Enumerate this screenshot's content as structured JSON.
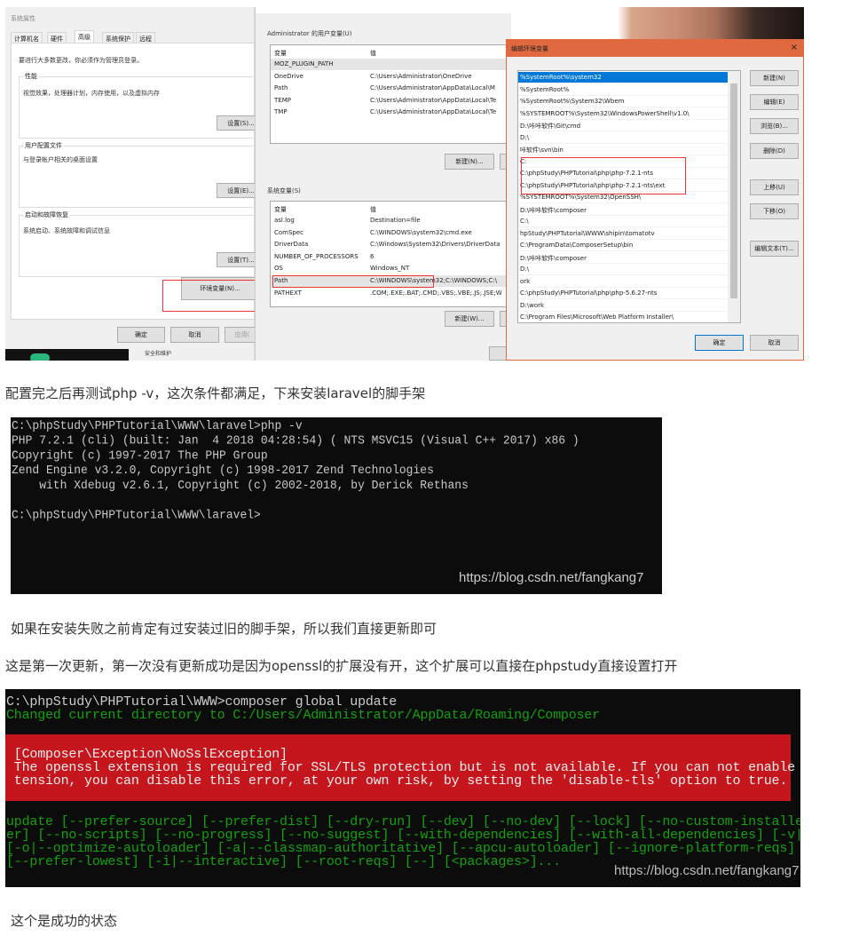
{
  "screenshot1": {
    "system_properties": {
      "title": "系统属性",
      "tabs": [
        "计算机名",
        "硬件",
        "高级",
        "系统保护",
        "远程"
      ],
      "active_tab": "高级",
      "admin_note": "要进行大多数更改，你必须作为管理员登录。",
      "groups": [
        {
          "label": "性能",
          "desc": "视觉效果，处理器计划，内存使用，以及虚拟内存",
          "button": "设置(S)..."
        },
        {
          "label": "用户配置文件",
          "desc": "与登录帐户相关的桌面设置",
          "button": "设置(E)..."
        },
        {
          "label": "启动和故障恢复",
          "desc": "系统启动、系统故障和调试信息",
          "button": "设置(T)..."
        }
      ],
      "env_button": "环境变量(N)...",
      "ok": "确定",
      "cancel": "取消",
      "apply": "应用(",
      "behind_text": "安全和维护"
    },
    "env_vars": {
      "user_label": "Administrator 的用户变量(U)",
      "col_var": "变量",
      "col_val": "值",
      "user_rows": [
        [
          "MOZ_PLUGIN_PATH",
          ""
        ],
        [
          "OneDrive",
          "C:\\Users\\Administrator\\OneDrive"
        ],
        [
          "Path",
          "C:\\Users\\Administrator\\AppData\\Local\\M"
        ],
        [
          "TEMP",
          "C:\\Users\\Administrator\\AppData\\Local\\Te"
        ],
        [
          "TMP",
          "C:\\Users\\Administrator\\AppData\\Local\\Te"
        ]
      ],
      "user_new": "新建(N)...",
      "sys_label": "系统变量(S)",
      "sys_rows": [
        [
          "asl.log",
          "Destination=file"
        ],
        [
          "ComSpec",
          "C:\\WINDOWS\\system32\\cmd.exe"
        ],
        [
          "DriverData",
          "C:\\Windows\\System32\\Drivers\\DriverData"
        ],
        [
          "NUMBER_OF_PROCESSORS",
          "6"
        ],
        [
          "OS",
          "Windows_NT"
        ],
        [
          "Path",
          "C:\\WINDOWS\\system32;C:\\WINDOWS;C:\\"
        ],
        [
          "PATHEXT",
          ".COM;.EXE;.BAT;.CMD;.VBS;.VBE;.JS;.JSE;W"
        ]
      ],
      "sys_new": "新建(W)..."
    },
    "edit_env": {
      "title": "编辑环境变量",
      "close": "×",
      "entries": [
        "%SystemRoot%\\system32",
        "%SystemRoot%",
        "%SystemRoot%\\System32\\Wbem",
        "%SYSTEMROOT%\\System32\\WindowsPowerShell\\v1.0\\",
        "D:\\咔咔软件\\Git\\cmd",
        "D:\\",
        "咔软件\\svn\\bin",
        "C:",
        "C:\\phpStudy\\PHPTutorial\\php\\php-7.2.1-nts",
        "C:\\phpStudy\\PHPTutorial\\php\\php-7.2.1-nts\\ext",
        "%SYSTEMROOT%\\System32\\OpenSSH\\",
        "D:\\咔咔软件\\composer",
        "C:\\",
        "hpStudy\\PHPTutorial\\WWW\\shipin\\tomatotv",
        "C:\\ProgramData\\ComposerSetup\\bin",
        "D:\\咔咔软件\\composer",
        "D:\\",
        "ork",
        "C:\\phpStudy\\PHPTutorial\\php\\php-5.6.27-nts",
        "D:\\work",
        "C:\\Program Files\\Microsoft\\Web Platform Installer\\"
      ],
      "buttons": [
        "新建(N)",
        "编辑(E)",
        "浏览(B)...",
        "删除(D)",
        "上移(U)",
        "下移(O)",
        "编辑文本(T)..."
      ],
      "ok": "确定",
      "cancel": "取消",
      "selected_color": "#0078d7",
      "title_color": "#e0693f"
    }
  },
  "para1": "配置完之后再测试php -v，这次条件都满足，下来安装laravel的脚手架",
  "terminal1": {
    "text": "C:\\phpStudy\\PHPTutorial\\WWW\\laravel>php -v\nPHP 7.2.1 (cli) (built: Jan  4 2018 04:28:54) ( NTS MSVC15 (Visual C++ 2017) x86 )\nCopyright (c) 1997-2017 The PHP Group\nZend Engine v3.2.0, Copyright (c) 1998-2017 Zend Technologies\n    with Xdebug v2.6.1, Copyright (c) 2002-2018, by Derick Rethans\n\nC:\\phpStudy\\PHPTutorial\\WWW\\laravel>",
    "watermark": "https://blog.csdn.net/fangkang7"
  },
  "para2": "如果在安装失败之前肯定有过安装过旧的脚手架，所以我们直接更新即可",
  "para3": "这是第一次更新，第一次没有更新成功是因为openssl的扩展没有开，这个扩展可以直接在phpstudy直接设置打开",
  "terminal2": {
    "command": "C:\\phpStudy\\PHPTutorial\\WWW>composer global update",
    "changed_dir": "Changed current directory to C:/Users/Administrator/AppData/Roaming/Composer",
    "error": " [Composer\\Exception\\NoSslException]\n The openssl extension is required for SSL/TLS protection but is not available. If you can not enable the openssl ex\n tension, you can disable this error, at your own risk, by setting the 'disable-tls' option to true.",
    "usage": "update [--prefer-source] [--prefer-dist] [--dry-run] [--dev] [--no-dev] [--lock] [--no-custom-installers] [--no-autoload\ner] [--no-scripts] [--no-progress] [--no-suggest] [--with-dependencies] [--with-all-dependencies] [-v|vv|vvv|--verbose]\n[-o|--optimize-autoloader] [-a|--classmap-authoritative] [--apcu-autoloader] [--ignore-platform-reqs] [--prefer-stable]\n[--prefer-lowest] [-i|--interactive] [--root-reqs] [--] [<packages>]...",
    "watermark": "https://blog.csdn.net/fangkang7",
    "error_bg": "#c4161c",
    "green": "#13a10e"
  },
  "para4": "这个是成功的状态"
}
